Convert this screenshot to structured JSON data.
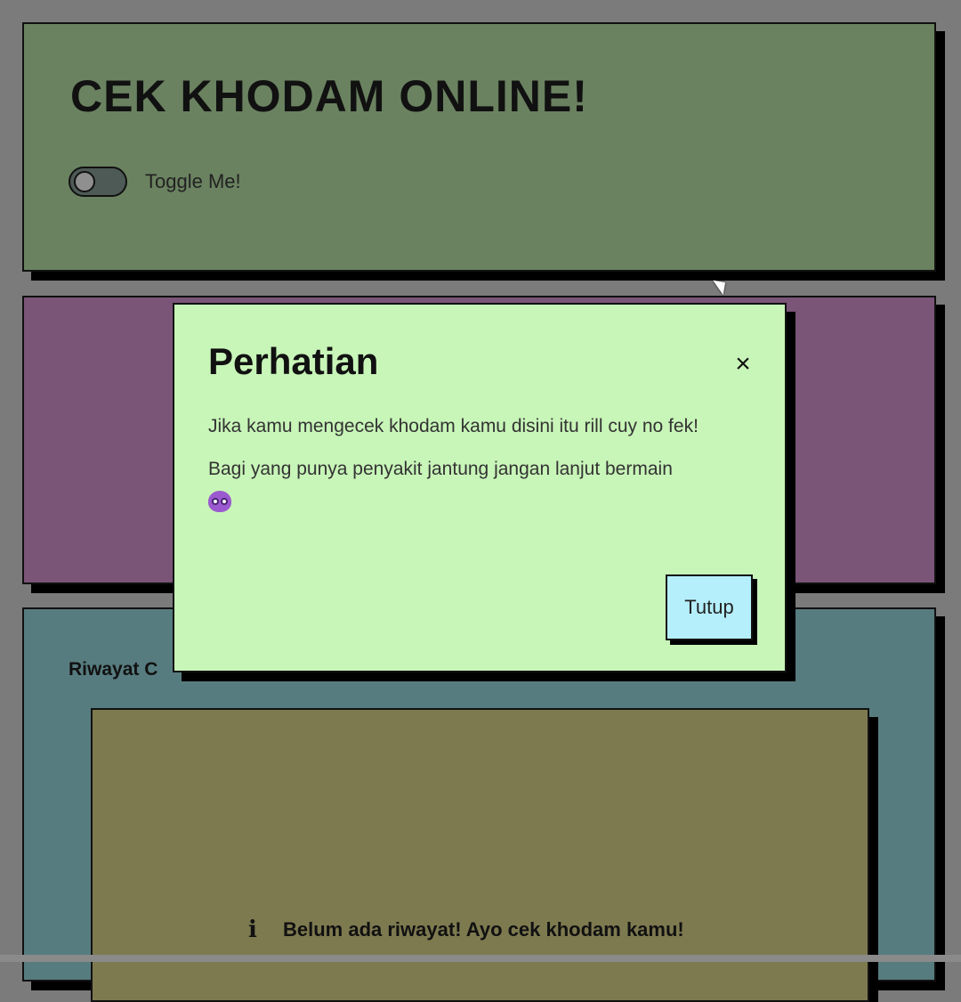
{
  "header": {
    "title": "CEK KHODAM ONLINE!",
    "toggle_label": "Toggle Me!",
    "toggle_on": false
  },
  "history": {
    "title": "Riwayat C",
    "empty_message": "Belum ada riwayat! Ayo cek khodam kamu!",
    "icon": "info-icon"
  },
  "modal": {
    "title": "Perhatian",
    "close_icon": "close-icon",
    "paragraph1": "Jika kamu mengecek khodam kamu disini itu rill cuy no fek!",
    "paragraph2": "Bagi yang punya penyakit jantung jangan lanjut bermain",
    "emoji_icon": "owl-emoji-icon",
    "button_label": "Tutup"
  },
  "colors": {
    "background": "#7b7b7b",
    "header_card": "#6a8260",
    "middle_card": "#7a5578",
    "history_card": "#577c7f",
    "history_panel": "#7e7a50",
    "modal": "#c8f5b8",
    "modal_button": "#b5effc"
  }
}
